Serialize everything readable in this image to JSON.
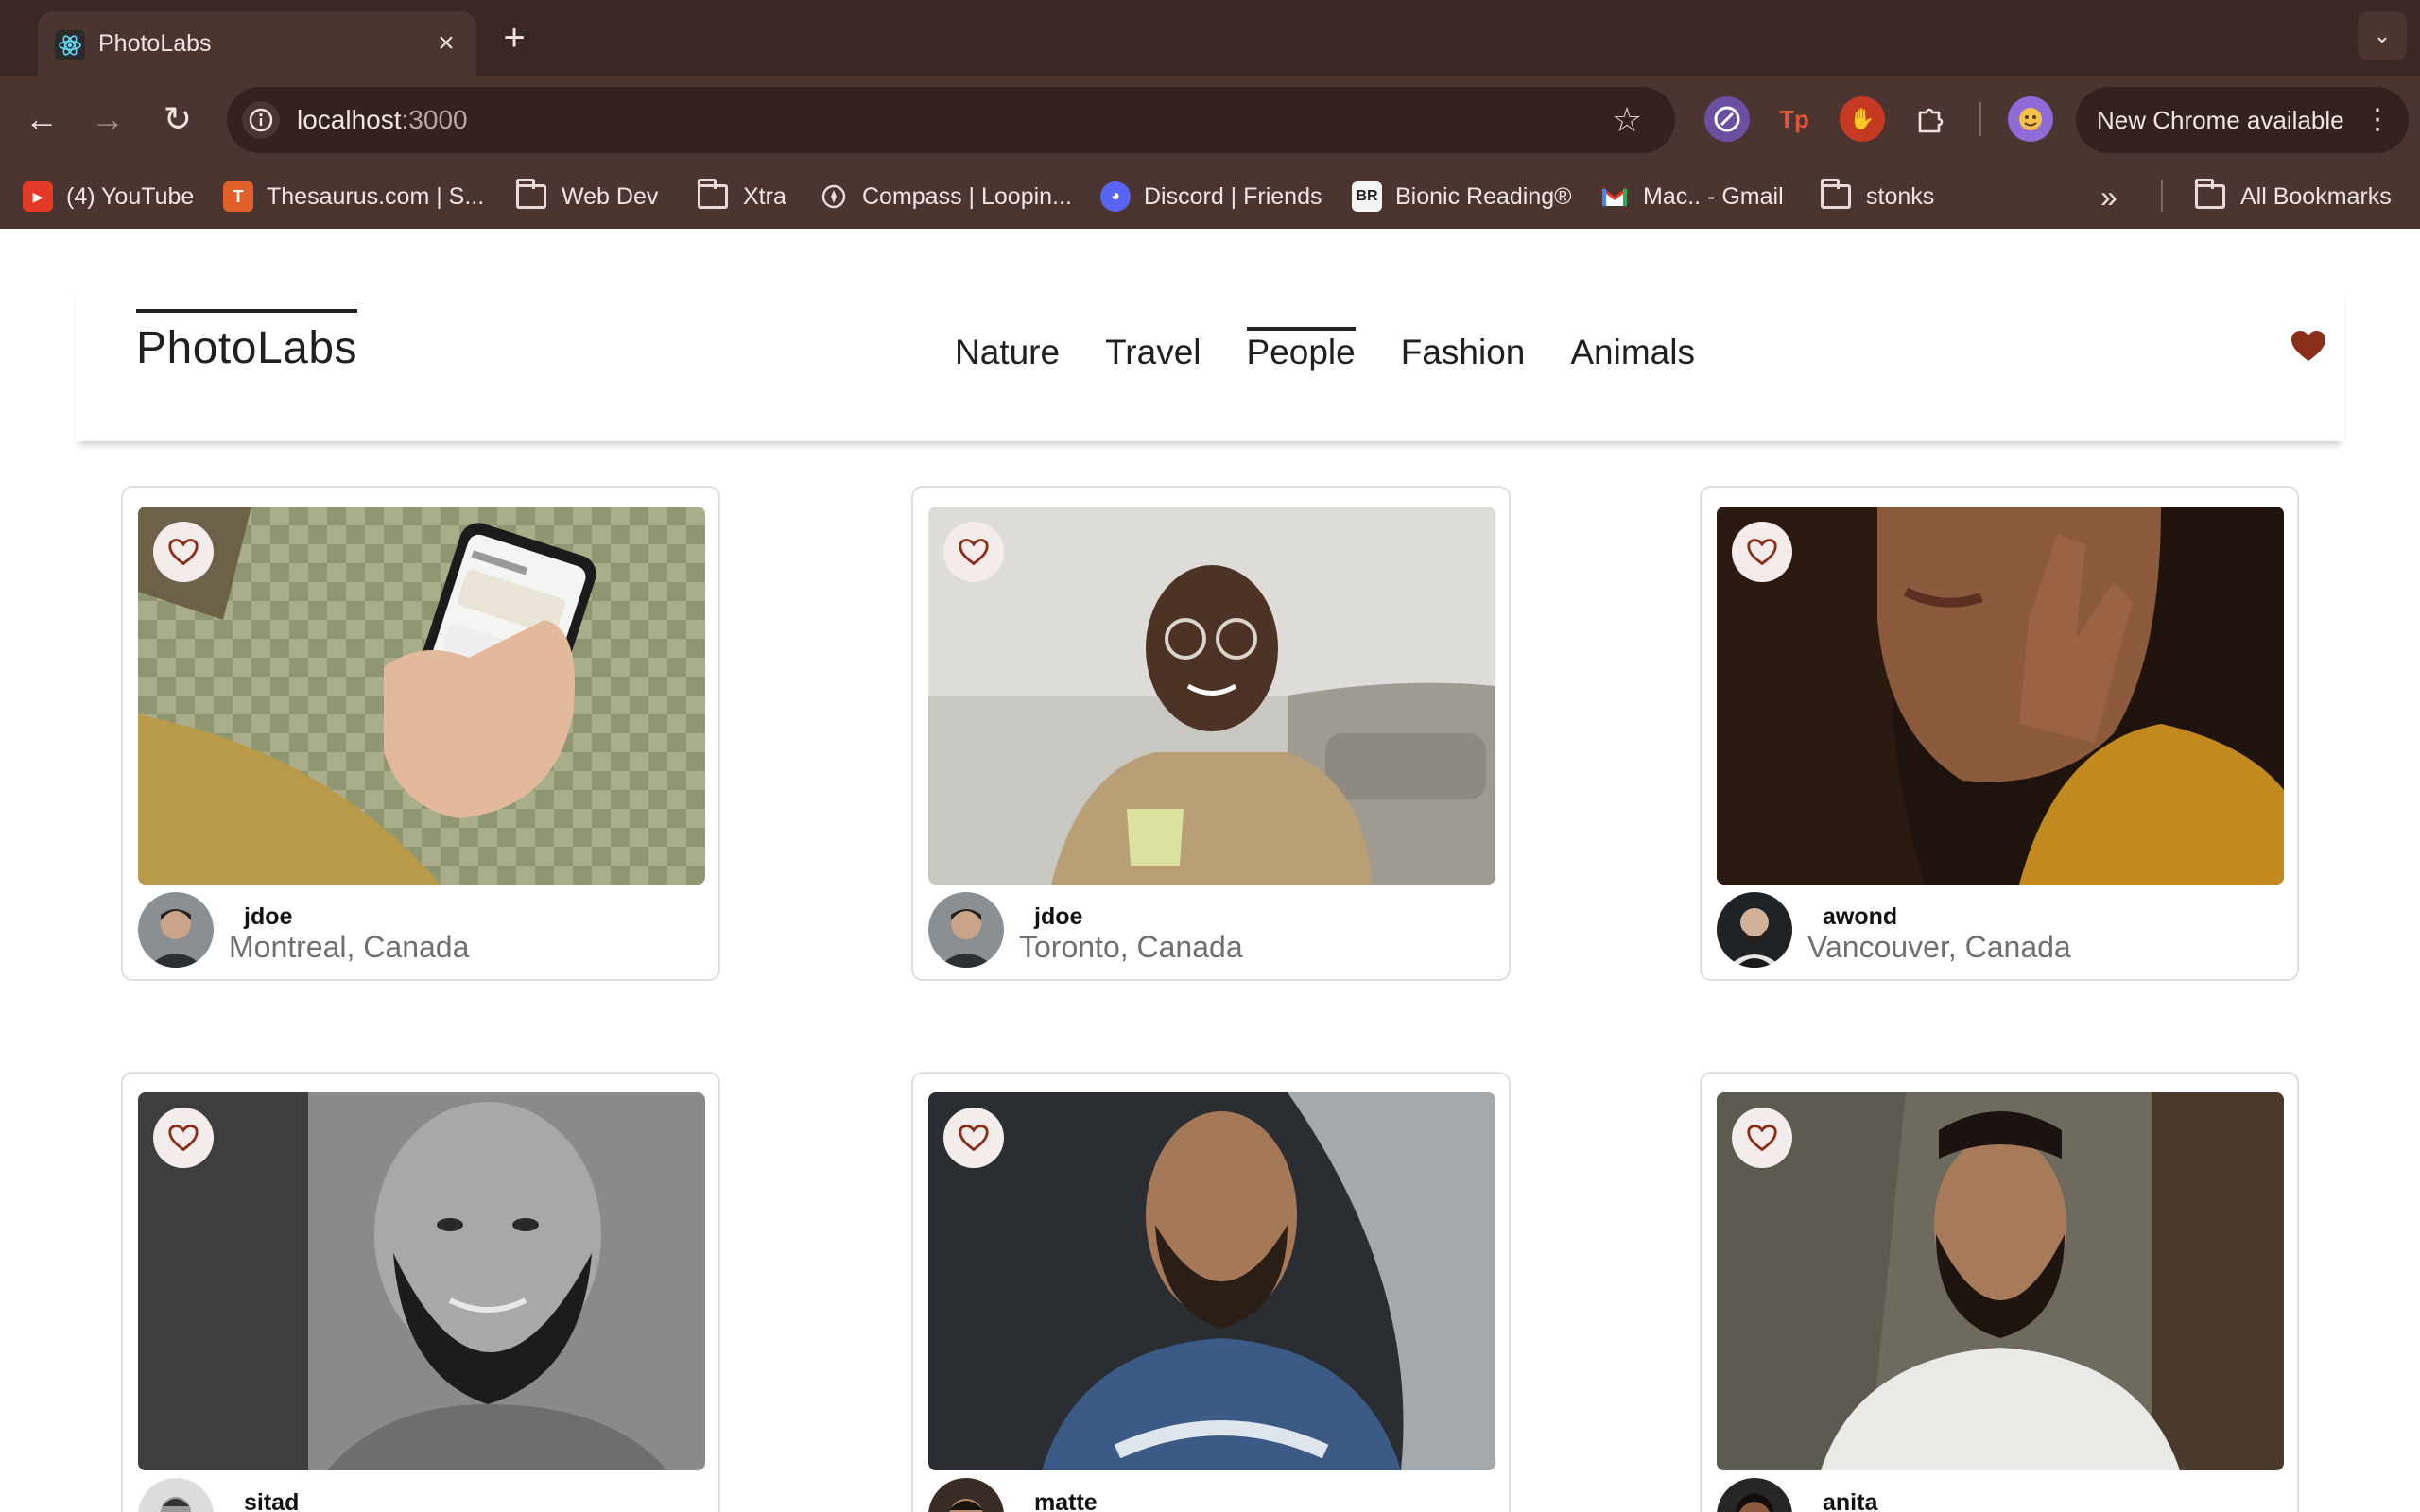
{
  "browser": {
    "tab_title": "PhotoLabs",
    "url_host": "localhost",
    "url_port": ":3000",
    "new_chrome_label": "New Chrome available",
    "bookmarks": [
      {
        "label": "(4) YouTube"
      },
      {
        "label": "Thesaurus.com | S..."
      },
      {
        "label": "Web Dev"
      },
      {
        "label": "Xtra"
      },
      {
        "label": "Compass | Loopin..."
      },
      {
        "label": "Discord | Friends"
      },
      {
        "label": "Bionic Reading®"
      },
      {
        "label": "Mac.. - Gmail"
      },
      {
        "label": "stonks"
      }
    ],
    "all_bookmarks_label": "All Bookmarks"
  },
  "app": {
    "logo": "PhotoLabs",
    "topics": [
      {
        "label": "Nature"
      },
      {
        "label": "Travel"
      },
      {
        "label": "People",
        "active": true
      },
      {
        "label": "Fashion"
      },
      {
        "label": "Animals"
      }
    ],
    "accent_color": "#8a2e1a"
  },
  "photos": [
    {
      "username": "jdoe",
      "location": "Montreal, Canada",
      "subject": "hand-holding-phone"
    },
    {
      "username": "jdoe",
      "location": "Toronto, Canada",
      "subject": "man-with-mug"
    },
    {
      "username": "awond",
      "location": "Vancouver, Canada",
      "subject": "woman-portrait"
    },
    {
      "username": "sitad",
      "location": "",
      "subject": "bearded-man-bw"
    },
    {
      "username": "matte",
      "location": "",
      "subject": "man-blue-shirt"
    },
    {
      "username": "anita",
      "location": "",
      "subject": "man-white-shirt"
    }
  ]
}
